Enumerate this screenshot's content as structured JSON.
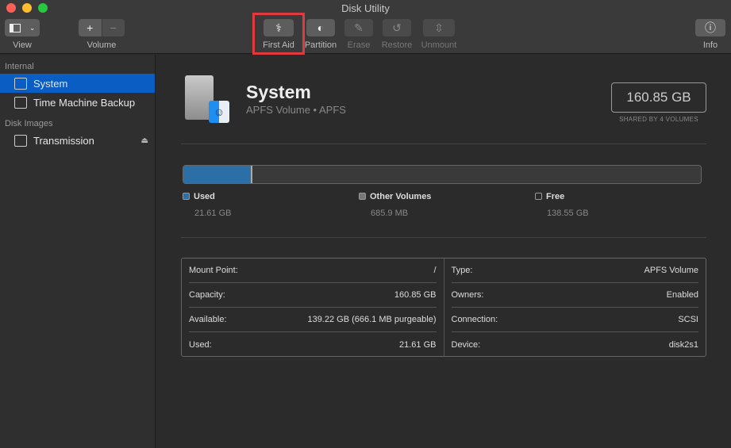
{
  "window": {
    "title": "Disk Utility"
  },
  "toolbar": {
    "view": "View",
    "volume": "Volume",
    "first_aid": "First Aid",
    "partition": "Partition",
    "erase": "Erase",
    "restore": "Restore",
    "unmount": "Unmount",
    "info": "Info",
    "plus": "+",
    "minus": "−",
    "info_glyph": "ⓘ"
  },
  "sidebar": {
    "internal": "Internal",
    "disk_images": "Disk Images",
    "items": [
      {
        "label": "System"
      },
      {
        "label": "Time Machine Backup"
      },
      {
        "label": "Transmission"
      }
    ]
  },
  "volume": {
    "name": "System",
    "subtitle": "APFS Volume • APFS",
    "capacity": "160.85 GB",
    "shared": "SHARED BY 4 VOLUMES"
  },
  "usage": {
    "used_fraction": 0.134,
    "colors": {
      "used": "#2c6fa6",
      "other": "#777777",
      "free": "#2b2b2b"
    },
    "legend": [
      {
        "name": "Used",
        "value": "21.61 GB"
      },
      {
        "name": "Other Volumes",
        "value": "685.9 MB"
      },
      {
        "name": "Free",
        "value": "138.55 GB"
      }
    ]
  },
  "details": {
    "left": [
      {
        "k": "Mount Point:",
        "v": "/"
      },
      {
        "k": "Capacity:",
        "v": "160.85 GB"
      },
      {
        "k": "Available:",
        "v": "139.22 GB (666.1 MB purgeable)"
      },
      {
        "k": "Used:",
        "v": "21.61 GB"
      }
    ],
    "right": [
      {
        "k": "Type:",
        "v": "APFS Volume"
      },
      {
        "k": "Owners:",
        "v": "Enabled"
      },
      {
        "k": "Connection:",
        "v": "SCSI"
      },
      {
        "k": "Device:",
        "v": "disk2s1"
      }
    ]
  }
}
